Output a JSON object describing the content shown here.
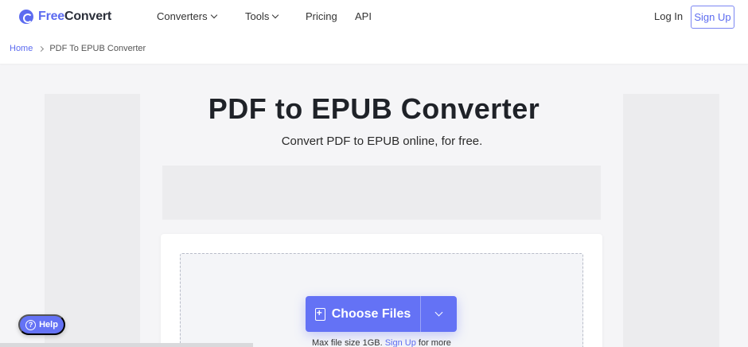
{
  "brand": {
    "name_part1": "Free",
    "name_part2": "Convert",
    "accent_color": "#5c6bf0"
  },
  "nav": {
    "items": [
      {
        "label": "Converters",
        "has_dropdown": true
      },
      {
        "label": "Tools",
        "has_dropdown": true
      },
      {
        "label": "Pricing",
        "has_dropdown": false
      },
      {
        "label": "API",
        "has_dropdown": false
      }
    ],
    "login_label": "Log In",
    "signup_label": "Sign Up"
  },
  "breadcrumb": {
    "home": "Home",
    "current": "PDF To EPUB Converter"
  },
  "hero": {
    "title": "PDF to EPUB Converter",
    "subtitle": "Convert PDF to EPUB online, for free."
  },
  "upload": {
    "choose_label": "Choose Files",
    "max_prefix": "Max file size 1GB.",
    "signup_link": "Sign Up",
    "max_suffix": "for more",
    "button_color": "#6472f5"
  },
  "help": {
    "label": "Help"
  },
  "icons": {
    "logo": "freeconvert-logo-icon",
    "dropdown": "chevron-down-icon",
    "breadcrumb_sep": "chevron-right-icon",
    "file_add": "file-add-icon",
    "help": "question-circle-icon"
  }
}
